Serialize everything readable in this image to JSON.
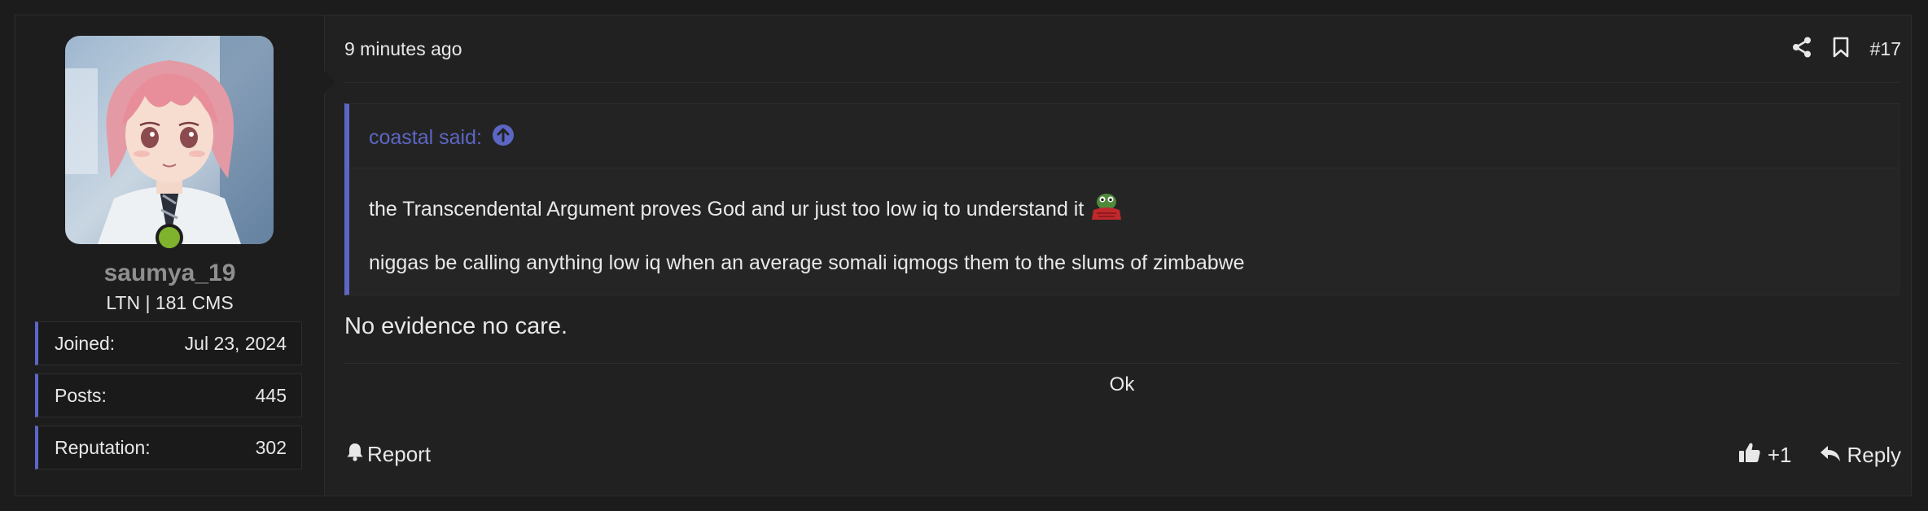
{
  "user": {
    "username": "saumya_19",
    "title": "LTN | 181 CMS",
    "status_color": "#7fb32d",
    "stats": [
      {
        "label": "Joined:",
        "value": "Jul 23, 2024"
      },
      {
        "label": "Posts:",
        "value": "445"
      },
      {
        "label": "Reputation:",
        "value": "302"
      }
    ]
  },
  "post": {
    "timestamp": "9 minutes ago",
    "number": "#17",
    "quote": {
      "author": "coastal said:",
      "line1": "the Transcendental Argument proves God and ur just too low iq to understand it",
      "line2": "niggas be calling anything low iq when an average somali iqmogs them to the slums of zimbabwe"
    },
    "body": "No evidence no care.",
    "signature": "Ok"
  },
  "footer": {
    "report_label": "Report",
    "like_count": "+1",
    "reply_label": "Reply"
  },
  "colors": {
    "accent": "#5c67c4",
    "background": "#212121"
  },
  "icons": [
    "share-icon",
    "bookmark-icon",
    "arrow-up-circle-icon",
    "pepe-emoji",
    "bell-icon",
    "thumbs-up-icon",
    "reply-icon"
  ]
}
